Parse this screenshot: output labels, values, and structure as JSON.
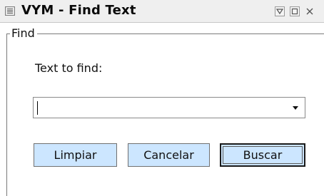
{
  "window": {
    "title": "VYM - Find Text"
  },
  "group": {
    "title": "Find"
  },
  "find": {
    "label": "Text to find:",
    "value": "",
    "placeholder": ""
  },
  "buttons": {
    "clear_label": "Limpiar",
    "cancel_label": "Cancelar",
    "search_label": "Buscar"
  },
  "colors": {
    "button_bg": "#cce6ff",
    "titlebar_bg": "#efefef"
  },
  "icons": {
    "sysmenu": "window-menu-icon",
    "shade": "shade-icon",
    "maximize": "maximize-icon",
    "close": "close-icon",
    "dropdown": "chevron-down-icon"
  }
}
